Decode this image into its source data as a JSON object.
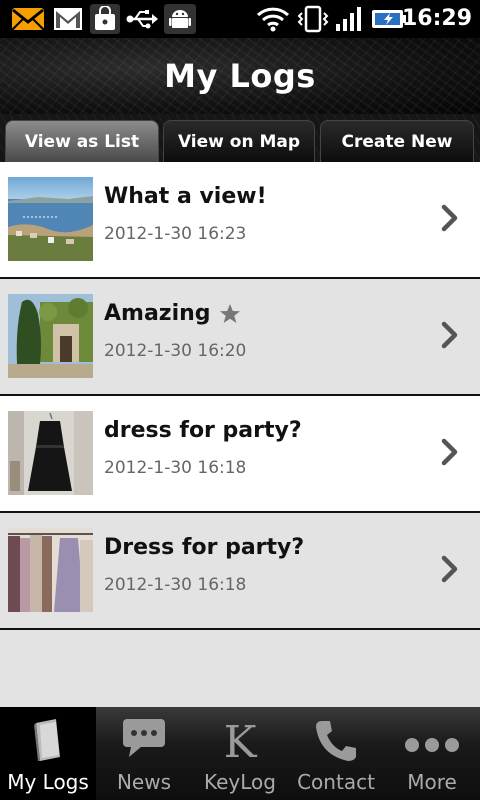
{
  "status_bar": {
    "time": "16:29",
    "icons": [
      "mail-alert-icon",
      "gmail-icon",
      "shopping-bag-icon",
      "usb-icon",
      "android-debug-icon",
      "wifi-icon",
      "vibrate-icon",
      "signal-icon",
      "battery-charging-icon"
    ]
  },
  "header": {
    "title": "My Logs"
  },
  "tabs": [
    {
      "label": "View as List",
      "active": true
    },
    {
      "label": "View on Map",
      "active": false
    },
    {
      "label": "Create New",
      "active": false
    }
  ],
  "logs": [
    {
      "title": "What a view!",
      "date": "2012-1-30 16:23",
      "starred": false,
      "thumb": "harbor-photo"
    },
    {
      "title": "Amazing",
      "date": "2012-1-30 16:20",
      "starred": true,
      "thumb": "garden-photo"
    },
    {
      "title": "dress for party?",
      "date": "2012-1-30 16:18",
      "starred": false,
      "thumb": "black-dress-photo"
    },
    {
      "title": "Dress for party?",
      "date": "2012-1-30 16:18",
      "starred": false,
      "thumb": "dress-rack-photo"
    }
  ],
  "bottom_nav": [
    {
      "label": "My Logs",
      "icon": "book-icon",
      "active": true
    },
    {
      "label": "News",
      "icon": "chat-bubble-icon",
      "active": false
    },
    {
      "label": "KeyLog",
      "icon": "k-letter-icon",
      "active": false
    },
    {
      "label": "Contact",
      "icon": "phone-icon",
      "active": false
    },
    {
      "label": "More",
      "icon": "more-dots-icon",
      "active": false
    }
  ],
  "colors": {
    "accent_active_tab": "#8c8c8c",
    "row_alt": "#e4e3e4",
    "date_text": "#666666"
  }
}
